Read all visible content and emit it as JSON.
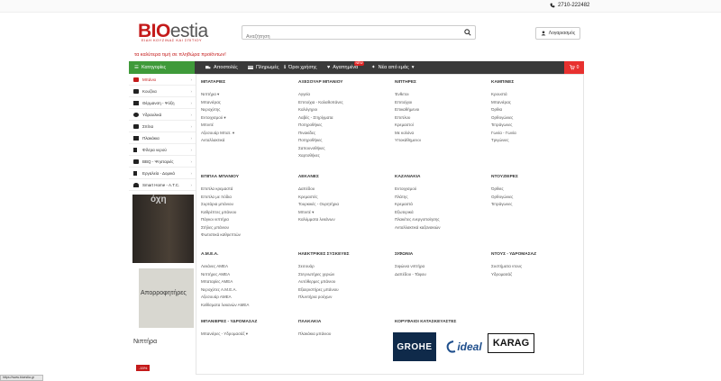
{
  "topbar": {
    "phone": "2710-222482"
  },
  "logo": {
    "bio": "BIO",
    "estia": "estia",
    "tagline": "ΕΙΔΗ ΚΟΥΖΙΝΑΣ ΚΑΙ ΣΠΙΤΙΟΥ",
    "slogan": "τα καλύτερα τιμή σε πληθώρα προϊόντων!"
  },
  "search": {
    "placeholder": "Αναζήτηση",
    "value": ""
  },
  "login": {
    "label": "Λογαριασμός"
  },
  "nav": {
    "categories": "Κατηγορίες",
    "items": [
      "Αποστολές",
      "Πληρωμές",
      "Όροι χρήσης",
      "Αγαπημένα",
      "Νέα από εμάς"
    ],
    "badge": "NEW",
    "cart_count": "0"
  },
  "sidebar": {
    "items": [
      {
        "label": "Μπάνιο",
        "icon": "bath-icon"
      },
      {
        "label": "Κουζίνα",
        "icon": "kitchen-icon"
      },
      {
        "label": "Θέρμανση - Ψύξη",
        "icon": "heater-icon"
      },
      {
        "label": "Υδραυλικά",
        "icon": "plumbing-icon"
      },
      {
        "label": "Σπίτια",
        "icon": "home-icon"
      },
      {
        "label": "Πλακάκια",
        "icon": "tiles-icon"
      },
      {
        "label": "Φίλτρα νερού",
        "icon": "filter-icon"
      },
      {
        "label": "BBQ - Ψησταριές",
        "icon": "grill-icon"
      },
      {
        "label": "Εργαλεία - Δομικά",
        "icon": "tools-icon"
      },
      {
        "label": "Smart Home - A.T.C.",
        "icon": "wifi-icon"
      }
    ]
  },
  "banners": {
    "dark": "όχη",
    "grey": "Απορροφητήρες"
  },
  "niptira": "Νιπτήρα",
  "sale": "-15%",
  "statusbar": "https://www.bioestia.gr",
  "mega": {
    "columns": [
      {
        "head": "ΜΠΑΤΑΡΙΕΣ",
        "items": [
          "Νιπτήρα",
          "Μπανιέρας",
          "Νεροχύτης",
          "Εντοιχισμού",
          "Μπιντέ",
          "Αξεσουάρ Μπατ.",
          "Ανταλλακτικά"
        ]
      },
      {
        "head": "ΑΞΕΣΟΥΑΡ ΜΠΑΝΙΟΥ",
        "items": [
          "Αγγεία",
          "Επιτοίχια - Καλαθοπάνες",
          "Καλόγηροι",
          "Λαβές - Στηρίγματα",
          "Ποτηροθήκες",
          "Πινακίδες",
          "Ποτηροθήκες",
          "Σαπουνοθήκες",
          "Χαρτοθήκες"
        ]
      },
      {
        "head": "ΝΙΠΤΗΡΕΣ",
        "items": [
          "Ένθετοι",
          "Επιτοίχιοι",
          "Επικαθήμενοι",
          "Επιπλου",
          "Κρεμαστοί",
          "Με κολόνα",
          "Υποκάθημενοι"
        ]
      },
      {
        "head": "ΚΑΜΠΙΝΕΣ",
        "items": [
          "Κρουστά",
          "Μπανιέρας",
          "Όρθια",
          "Ορθογώνιες",
          "Τετράγωνες",
          "Γωνία - Γωνία",
          "Τριγώνιες"
        ]
      },
      {
        "head": "ΕΠΙΠΛΑ ΜΠΑΝΙΟΥ",
        "items": [
          "Επιπλα κρεμαστά",
          "Επιπλα με πόδια",
          "Συρτάρια μπάνιου",
          "Καθρέπτες μπάνιου",
          "Πάγκοι νιπτήρα",
          "Στήλες μπάνιου",
          "Φωτιστικά καθρεπτών"
        ]
      },
      {
        "head": "ΛΕΚΑΝΕΣ",
        "items": [
          "Δαπέδου",
          "Κρεμαστές",
          "Τουρκικές - Ουρητήρια",
          "Μπιντέ",
          "Καλύμματα λεκάνων"
        ]
      },
      {
        "head": "ΚΑΖΑΝΑΚΙΑ",
        "items": [
          "Εντοιχισμού",
          "Πλάτης",
          "Κρεμαστά",
          "Εξωτερικά",
          "Πλακέτες ενεργοποίησης",
          "Ανταλλακτικά καζανακιών"
        ]
      },
      {
        "head": "ΝΤΟΥΖΙΕΡΕΣ",
        "items": [
          "Όρθιες",
          "Ορθογώνιες",
          "Τετράγωνες"
        ]
      },
      {
        "head": "Α.Μ.Ε.Α.",
        "items": [
          "Λεκάνες ΑΜΕΑ",
          "Νιπτήρες ΑΜΕΑ",
          "Μπαταρίες ΑΜΕΑ",
          "Νεροχύτες Α.Μ.Ε.Α.",
          "Αξεσουάρ ΑΜΕΑ",
          "Καθίσματα λεκανών ΑΜΕΑ"
        ]
      },
      {
        "head": "ΗΛΕΚΤΡΙΚΕΣ ΣΥΣΚΕΥΕΣ",
        "items": [
          "Σεσουάρ",
          "Στεγνωτήρες χεριών",
          "Αυτόθερμες μπάνιου",
          "Εξαεριστήρες μπάνιου",
          "Πλυντήρια ρούχων"
        ]
      },
      {
        "head": "ΣΙΦΩΝΙΑ",
        "items": [
          "Σιφώνια νιπτήρα",
          "Δαπέδου - Τάφου"
        ]
      },
      {
        "head": "ΝΤΟΥΣ - ΥΔΡΟΜΑΣΑΖ",
        "items": [
          "Συστήματα ντους",
          "Υδρομασάζ"
        ]
      },
      {
        "head": "ΜΠΑΝΙΕΡΕΣ - ΥΔΡΟΜΑΣΑΖ",
        "items": [
          "Μπανιέρες - Υδρομασάζ"
        ]
      },
      {
        "head": "ΠΛΑΚΑΚΙΑ",
        "items": [
          "Πλακάκια μπάνιου"
        ]
      },
      {
        "head": "ΚΟΡΥΦΑΙΟΙ ΚΑΤΑΣΚΕΥΑΣΤΕΣ",
        "items": []
      }
    ],
    "brands": [
      "GROHE",
      "ideal",
      "KARAG"
    ]
  }
}
